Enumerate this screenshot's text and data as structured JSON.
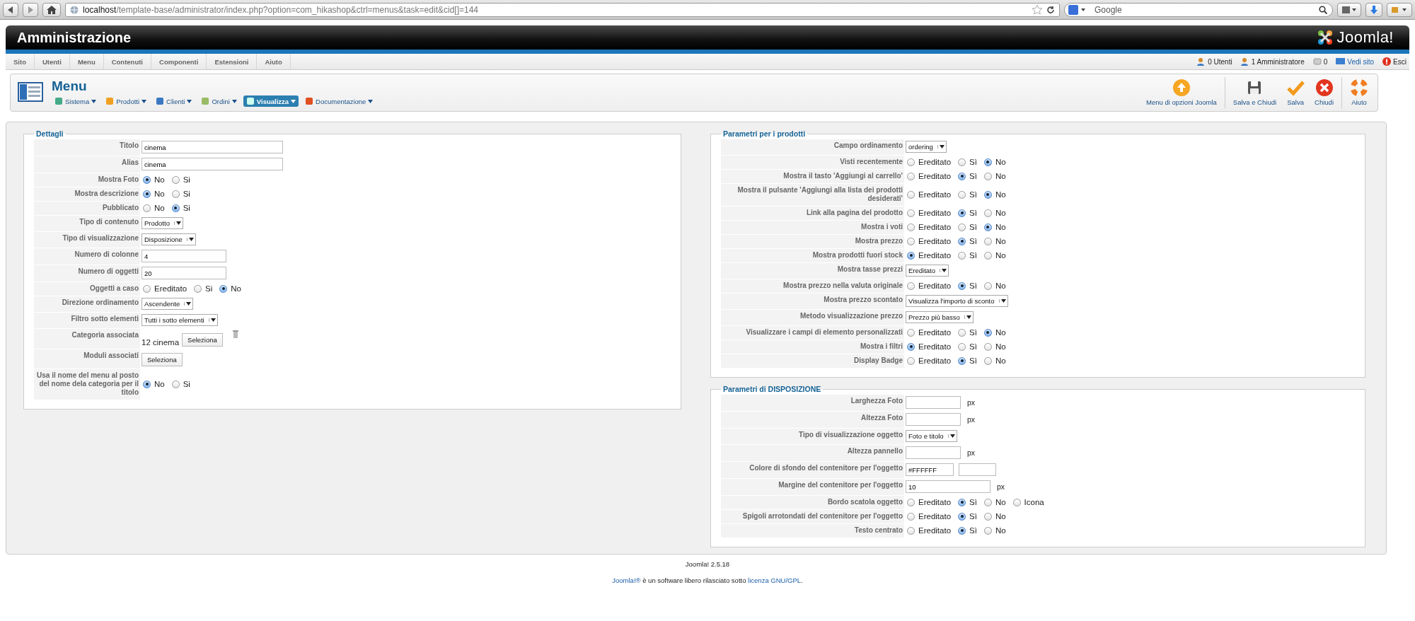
{
  "browser": {
    "url": "**localhost**/template-base/administrator/index.php?option=com_hikashop&ctrl=menus&task=edit&cid[]=144",
    "search_placeholder": "Google"
  },
  "header": {
    "title": "Amministrazione",
    "logo_text": "Joomla!"
  },
  "menu_bar": [
    "Sito",
    "Utenti",
    "Menu",
    "Contenuti",
    "Componenti",
    "Estensioni",
    "Aiuto"
  ],
  "status": [
    {
      "label": "0 Utenti",
      "kind": "text"
    },
    {
      "label": "1 Amministratore",
      "kind": "text"
    },
    {
      "label": "0",
      "kind": "text"
    },
    {
      "label": "Vedi sito",
      "kind": "link"
    },
    {
      "label": "Esci",
      "kind": "text"
    }
  ],
  "toolbar": {
    "title": "Menu",
    "menus": [
      {
        "label": "Sistema",
        "selected": false
      },
      {
        "label": "Prodotti",
        "selected": false
      },
      {
        "label": "Clienti",
        "selected": false
      },
      {
        "label": "Ordini",
        "selected": false
      },
      {
        "label": "Visualizza",
        "selected": true
      },
      {
        "label": "Documentazione",
        "selected": false
      }
    ],
    "buttons": [
      "Menu di opzioni Joomla",
      "Salva e Chiudi",
      "Salva",
      "Chiudi",
      "Aiuto"
    ]
  },
  "panels": [
    {
      "legend": "Dettagli",
      "fields": [
        {
          "label": "Titolo",
          "kind": "text",
          "value": "cinema"
        },
        {
          "label": "Alias",
          "kind": "text",
          "value": "cinema"
        },
        {
          "label": "Mostra Foto",
          "kind": "radio",
          "options": [
            {
              "label": "No",
              "selected": true
            },
            {
              "label": "Si",
              "selected": false
            }
          ]
        },
        {
          "label": "Mostra descrizione",
          "kind": "radio",
          "options": [
            {
              "label": "No",
              "selected": true
            },
            {
              "label": "Si",
              "selected": false
            }
          ]
        },
        {
          "label": "Pubblicato",
          "kind": "radio",
          "options": [
            {
              "label": "No",
              "selected": false
            },
            {
              "label": "Si",
              "selected": true
            }
          ]
        },
        {
          "label": "Tipo di contenuto",
          "kind": "select",
          "value": "Prodotto"
        },
        {
          "label": "Tipo di visualizzazione",
          "kind": "select",
          "value": "Disposizione"
        },
        {
          "label": "Numero di colonne",
          "kind": "number",
          "value": "4"
        },
        {
          "label": "Numero di oggetti",
          "kind": "number",
          "value": "20"
        },
        {
          "label": "Oggetti a caso",
          "kind": "radio",
          "options": [
            {
              "label": "Ereditato",
              "selected": false
            },
            {
              "label": "Si",
              "selected": false
            },
            {
              "label": "No",
              "selected": true
            }
          ]
        },
        {
          "label": "Direzione ordinamento",
          "kind": "select",
          "value": "Ascendente"
        },
        {
          "label": "Filtro sotto elementi",
          "kind": "select",
          "value": "Tutti i sotto elementi"
        },
        {
          "label": "Categoria associata",
          "kind": "category",
          "value": "12 cinema",
          "button": "Seleziona"
        },
        {
          "label": "Moduli associati",
          "kind": "button",
          "button": "Seleziona"
        },
        {
          "label": "Usa il nome del menu al posto del nome dela categoria per il titolo",
          "kind": "radio",
          "options": [
            {
              "label": "No",
              "selected": true
            },
            {
              "label": "Si",
              "selected": false
            }
          ]
        }
      ]
    },
    {
      "legend": "Parametri per i prodotti",
      "fields": [
        {
          "label": "Campo ordinamento",
          "kind": "select",
          "value": "ordering"
        },
        {
          "label": "Visti recentemente",
          "kind": "radio",
          "options": [
            {
              "label": "Ereditato",
              "selected": false
            },
            {
              "label": "Sì",
              "selected": false
            },
            {
              "label": "No",
              "selected": true
            }
          ]
        },
        {
          "label": "Mostra il tasto 'Aggiungi al carrello'",
          "kind": "radio",
          "options": [
            {
              "label": "Ereditato",
              "selected": false
            },
            {
              "label": "Sì",
              "selected": true
            },
            {
              "label": "No",
              "selected": false
            }
          ]
        },
        {
          "label": "Mostra il pulsante 'Aggiungi alla lista dei prodotti desiderati'",
          "kind": "radio",
          "options": [
            {
              "label": "Ereditato",
              "selected": false
            },
            {
              "label": "Sì",
              "selected": false
            },
            {
              "label": "No",
              "selected": true
            }
          ]
        },
        {
          "label": "Link alla pagina del prodotto",
          "kind": "radio",
          "options": [
            {
              "label": "Ereditato",
              "selected": false
            },
            {
              "label": "Sì",
              "selected": true
            },
            {
              "label": "No",
              "selected": false
            }
          ]
        },
        {
          "label": "Mostra i voti",
          "kind": "radio",
          "options": [
            {
              "label": "Ereditato",
              "selected": false
            },
            {
              "label": "Sì",
              "selected": false
            },
            {
              "label": "No",
              "selected": true
            }
          ]
        },
        {
          "label": "Mostra prezzo",
          "kind": "radio",
          "options": [
            {
              "label": "Ereditato",
              "selected": false
            },
            {
              "label": "Sì",
              "selected": true
            },
            {
              "label": "No",
              "selected": false
            }
          ]
        },
        {
          "label": "Mostra prodotti fuori stock",
          "kind": "radio",
          "options": [
            {
              "label": "Ereditato",
              "selected": true
            },
            {
              "label": "Sì",
              "selected": false
            },
            {
              "label": "No",
              "selected": false
            }
          ]
        },
        {
          "label": "Mostra tasse prezzi",
          "kind": "select",
          "value": "Ereditato"
        },
        {
          "label": "Mostra prezzo nella valuta originale",
          "kind": "radio",
          "options": [
            {
              "label": "Ereditato",
              "selected": false
            },
            {
              "label": "Sì",
              "selected": true
            },
            {
              "label": "No",
              "selected": false
            }
          ]
        },
        {
          "label": "Mostra prezzo scontato",
          "kind": "select",
          "value": "Visualizza l'importo di sconto"
        },
        {
          "label": "Metodo visualizzazione prezzo",
          "kind": "select",
          "value": "Prezzo più basso"
        },
        {
          "label": "Visualizzare i campi di elemento personalizzati",
          "kind": "radio",
          "options": [
            {
              "label": "Ereditato",
              "selected": false
            },
            {
              "label": "Sì",
              "selected": false
            },
            {
              "label": "No",
              "selected": true
            }
          ]
        },
        {
          "label": "Mostra i filtri",
          "kind": "radio",
          "options": [
            {
              "label": "Ereditato",
              "selected": true
            },
            {
              "label": "Sì",
              "selected": false
            },
            {
              "label": "No",
              "selected": false
            }
          ]
        },
        {
          "label": "Display Badge",
          "kind": "radio",
          "options": [
            {
              "label": "Ereditato",
              "selected": false
            },
            {
              "label": "Sì",
              "selected": true
            },
            {
              "label": "No",
              "selected": false
            }
          ]
        }
      ]
    },
    {
      "legend": "Parametri di DISPOSIZIONE",
      "fields": [
        {
          "label": "Larghezza Foto",
          "kind": "dimension",
          "suffix": "px"
        },
        {
          "label": "Altezza Foto",
          "kind": "dimension",
          "suffix": "px"
        },
        {
          "label": "Tipo di visualizzazione oggetto",
          "kind": "select",
          "value": "Foto e titolo"
        },
        {
          "label": "Altezza pannello",
          "kind": "dimension",
          "suffix": "px"
        },
        {
          "label": "Colore di sfondo del contenitore per l'oggetto",
          "kind": "color",
          "value": "#FFFFFF"
        },
        {
          "label": "Margine del contenitore per l'oggetto",
          "kind": "number",
          "value": "10",
          "suffix": "px"
        },
        {
          "label": "Bordo scatola oggetto",
          "kind": "radio",
          "options": [
            {
              "label": "Ereditato",
              "selected": false
            },
            {
              "label": "Sì",
              "selected": true
            },
            {
              "label": "No",
              "selected": false
            },
            {
              "label": "Icona",
              "selected": false
            }
          ]
        },
        {
          "label": "Spigoli arrotondati del contenitore per l'oggetto",
          "kind": "radio",
          "options": [
            {
              "label": "Ereditato",
              "selected": false
            },
            {
              "label": "Sì",
              "selected": true
            },
            {
              "label": "No",
              "selected": false
            }
          ]
        },
        {
          "label": "Testo centrato",
          "kind": "radio",
          "options": [
            {
              "label": "Ereditato",
              "selected": false
            },
            {
              "label": "Sì",
              "selected": true
            },
            {
              "label": "No",
              "selected": false
            }
          ]
        }
      ]
    }
  ],
  "footer": {
    "version": "Joomla! 2.5.18",
    "license": [
      {
        "kind": "link",
        "text": "Joomla!®"
      },
      {
        "kind": "text",
        "text": " è un software libero rilasciato sotto "
      },
      {
        "kind": "link",
        "text": "licenza GNU/GPL"
      },
      {
        "kind": "text",
        "text": "."
      }
    ]
  }
}
